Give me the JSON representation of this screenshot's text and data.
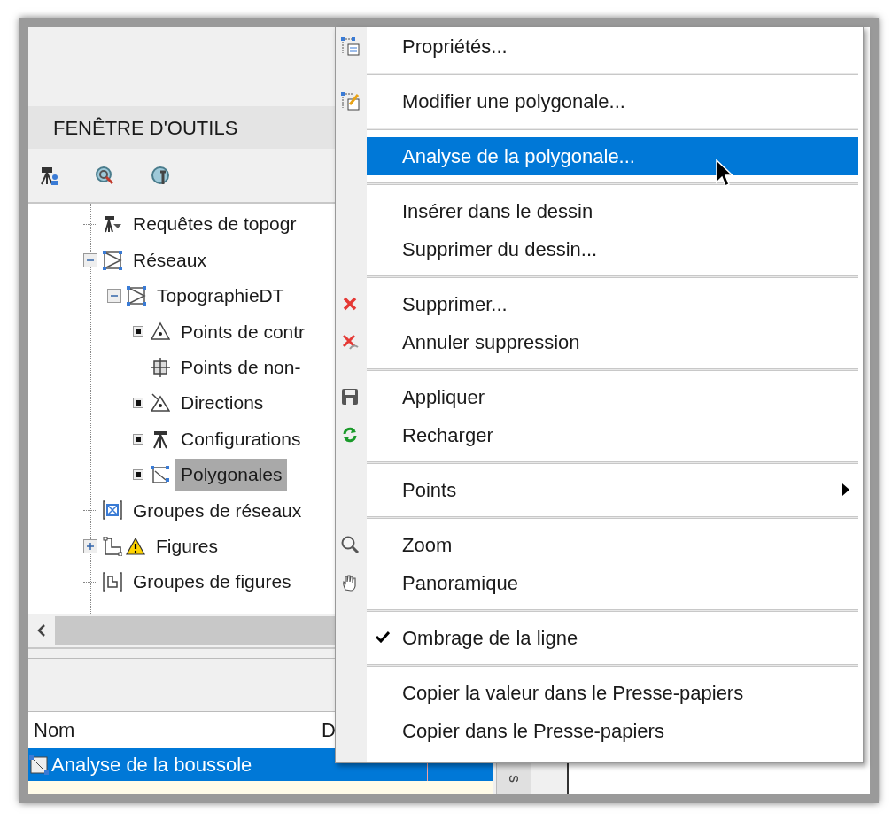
{
  "panel": {
    "title": "FENÊTRE D'OUTILS"
  },
  "tree": [
    {
      "label": "Requêtes de topogr",
      "kind": "leaf",
      "selected": false
    },
    {
      "label": "Réseaux",
      "kind": "folder",
      "expanded": true,
      "selected": false,
      "children": [
        {
          "label": "TopographieDT",
          "kind": "folder",
          "expanded": true,
          "selected": false,
          "children": [
            {
              "label": "Points de contr",
              "kind": "marker",
              "selected": false
            },
            {
              "label": "Points de non-",
              "kind": "leaf",
              "selected": false
            },
            {
              "label": "Directions",
              "kind": "marker",
              "selected": false
            },
            {
              "label": "Configurations",
              "kind": "marker",
              "selected": false
            },
            {
              "label": "Polygonales",
              "kind": "marker",
              "selected": true
            }
          ]
        }
      ]
    },
    {
      "label": "Groupes de réseaux",
      "kind": "leaf",
      "selected": false
    },
    {
      "label": "Figures",
      "kind": "folder",
      "expanded": false,
      "selected": false,
      "warning": true
    },
    {
      "label": "Groupes de figures",
      "kind": "leaf",
      "selected": false
    }
  ],
  "table": {
    "columns": [
      "Nom",
      "D"
    ],
    "rows": [
      {
        "cells": [
          "Analyse de la boussole"
        ],
        "selected": true
      }
    ]
  },
  "side_tab": {
    "label": "s"
  },
  "context_menu": {
    "groups": [
      [
        {
          "label": "Propriétés...",
          "selected": false,
          "checked": false,
          "submenu": false
        }
      ],
      [
        {
          "label": "Modifier une polygonale...",
          "selected": false,
          "checked": false,
          "submenu": false
        }
      ],
      [
        {
          "label": "Analyse de la polygonale...",
          "selected": true,
          "checked": false,
          "submenu": false
        }
      ],
      [
        {
          "label": "Insérer dans le dessin",
          "selected": false,
          "checked": false,
          "submenu": false
        },
        {
          "label": "Supprimer du dessin...",
          "selected": false,
          "checked": false,
          "submenu": false
        }
      ],
      [
        {
          "label": "Supprimer...",
          "selected": false,
          "checked": false,
          "submenu": false
        },
        {
          "label": "Annuler suppression",
          "selected": false,
          "checked": false,
          "submenu": false
        }
      ],
      [
        {
          "label": "Appliquer",
          "selected": false,
          "checked": false,
          "submenu": false
        },
        {
          "label": "Recharger",
          "selected": false,
          "checked": false,
          "submenu": false
        }
      ],
      [
        {
          "label": "Points",
          "selected": false,
          "checked": false,
          "submenu": true
        }
      ],
      [
        {
          "label": "Zoom",
          "selected": false,
          "checked": false,
          "submenu": false
        },
        {
          "label": "Panoramique",
          "selected": false,
          "checked": false,
          "submenu": false
        }
      ],
      [
        {
          "label": "Ombrage de la ligne",
          "selected": false,
          "checked": true,
          "submenu": false
        }
      ],
      [
        {
          "label": "Copier la valeur dans le Presse-papiers",
          "selected": false,
          "checked": false,
          "submenu": false
        },
        {
          "label": "Copier dans le Presse-papiers",
          "selected": false,
          "checked": false,
          "submenu": false
        }
      ]
    ]
  }
}
